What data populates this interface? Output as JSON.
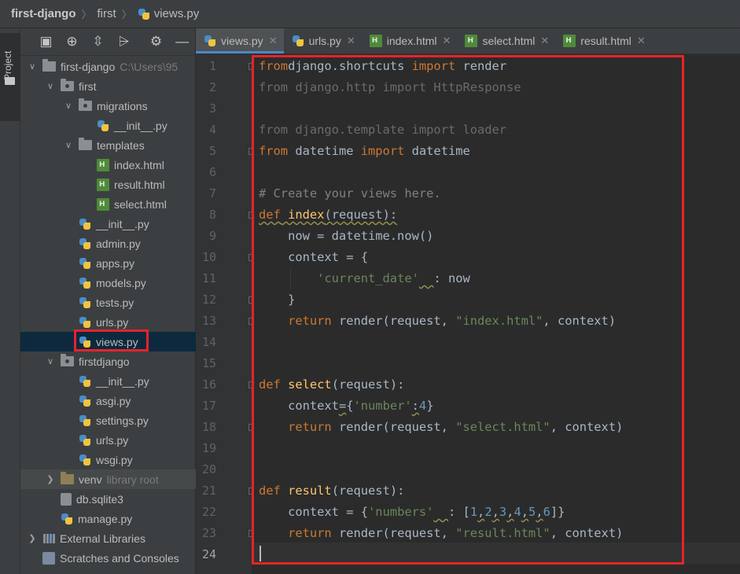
{
  "breadcrumb": [
    "first-django",
    "first",
    "views.py"
  ],
  "sidebar_tab": "Project",
  "panel_toolbar": [
    "project-view-icon",
    "locate-icon",
    "expand-all-icon",
    "collapse-all-icon",
    "gear-icon",
    "minimize-icon"
  ],
  "tree": [
    {
      "label": "first-django",
      "hint": "C:\\Users\\95",
      "kind": "folder",
      "depth": 0,
      "expanded": true
    },
    {
      "label": "first",
      "kind": "pkg",
      "depth": 1,
      "expanded": true
    },
    {
      "label": "migrations",
      "kind": "pkg",
      "depth": 2,
      "expanded": true
    },
    {
      "label": "__init__.py",
      "kind": "py",
      "depth": 3
    },
    {
      "label": "templates",
      "kind": "folder",
      "depth": 2,
      "expanded": true
    },
    {
      "label": "index.html",
      "kind": "html",
      "depth": 3
    },
    {
      "label": "result.html",
      "kind": "html",
      "depth": 3
    },
    {
      "label": "select.html",
      "kind": "html",
      "depth": 3
    },
    {
      "label": "__init__.py",
      "kind": "py",
      "depth": 2
    },
    {
      "label": "admin.py",
      "kind": "py",
      "depth": 2
    },
    {
      "label": "apps.py",
      "kind": "py",
      "depth": 2
    },
    {
      "label": "models.py",
      "kind": "py",
      "depth": 2
    },
    {
      "label": "tests.py",
      "kind": "py",
      "depth": 2
    },
    {
      "label": "urls.py",
      "kind": "py",
      "depth": 2
    },
    {
      "label": "views.py",
      "kind": "py",
      "depth": 2,
      "selected": true
    },
    {
      "label": "firstdjango",
      "kind": "pkg",
      "depth": 1,
      "expanded": true
    },
    {
      "label": "__init__.py",
      "kind": "py",
      "depth": 2
    },
    {
      "label": "asgi.py",
      "kind": "py",
      "depth": 2
    },
    {
      "label": "settings.py",
      "kind": "py",
      "depth": 2
    },
    {
      "label": "urls.py",
      "kind": "py",
      "depth": 2
    },
    {
      "label": "wsgi.py",
      "kind": "py",
      "depth": 2
    },
    {
      "label": "venv",
      "hint": "library root",
      "kind": "venv",
      "depth": 1,
      "expanded": false
    },
    {
      "label": "db.sqlite3",
      "kind": "db",
      "depth": 1
    },
    {
      "label": "manage.py",
      "kind": "py",
      "depth": 1
    },
    {
      "label": "External Libraries",
      "kind": "lib",
      "depth": 0,
      "expanded": false
    },
    {
      "label": "Scratches and Consoles",
      "kind": "scratch",
      "depth": 0
    }
  ],
  "tabs": [
    {
      "label": "views.py",
      "kind": "py",
      "active": true
    },
    {
      "label": "urls.py",
      "kind": "py"
    },
    {
      "label": "index.html",
      "kind": "html"
    },
    {
      "label": "select.html",
      "kind": "html"
    },
    {
      "label": "result.html",
      "kind": "html"
    }
  ],
  "code": [
    [
      [
        "kw",
        "from"
      ],
      [
        "",
        "django.shortcuts "
      ],
      [
        "kw",
        "import"
      ],
      [
        "",
        " render"
      ]
    ],
    [
      [
        "unused",
        "from django.http import HttpResponse"
      ]
    ],
    [],
    [
      [
        "unused",
        "from django.template import loader"
      ]
    ],
    [
      [
        "kw",
        "from"
      ],
      [
        "",
        " datetime "
      ],
      [
        "kw",
        "import"
      ],
      [
        "",
        " datetime"
      ]
    ],
    [],
    [
      [
        "cm",
        "# Create your views here."
      ]
    ],
    [
      [
        "kw squig",
        "def"
      ],
      [
        "squig",
        " "
      ],
      [
        "fn squig",
        "index"
      ],
      [
        "squig",
        "(request):"
      ]
    ],
    [
      [
        "",
        "    now = datetime.now()"
      ]
    ],
    [
      [
        "",
        "    context = {"
      ]
    ],
    [
      [
        "",
        "        "
      ],
      [
        "str",
        "'current_date'"
      ],
      [
        "squig",
        "  "
      ],
      [
        "",
        ": now"
      ]
    ],
    [
      [
        "",
        "    }"
      ]
    ],
    [
      [
        "",
        "    "
      ],
      [
        "kw",
        "return"
      ],
      [
        "",
        " render(request, "
      ],
      [
        "str",
        "\"index.html\""
      ],
      [
        "",
        ", context)"
      ]
    ],
    [],
    [],
    [
      [
        "kw",
        "def"
      ],
      [
        "",
        " "
      ],
      [
        "fn",
        "select"
      ],
      [
        "",
        "(request):"
      ]
    ],
    [
      [
        "",
        "    context"
      ],
      [
        "squig",
        "="
      ],
      [
        "",
        "{"
      ],
      [
        "str",
        "'number'"
      ],
      [
        "squig",
        ":"
      ],
      [
        "num",
        "4"
      ],
      [
        "",
        "}"
      ]
    ],
    [
      [
        "",
        "    "
      ],
      [
        "kw",
        "return"
      ],
      [
        "",
        " render(request, "
      ],
      [
        "str",
        "\"select.html\""
      ],
      [
        "",
        ", context)"
      ]
    ],
    [],
    [],
    [
      [
        "kw",
        "def"
      ],
      [
        "",
        " "
      ],
      [
        "fn",
        "result"
      ],
      [
        "",
        "(request):"
      ]
    ],
    [
      [
        "",
        "    context = {"
      ],
      [
        "str",
        "'numbers'"
      ],
      [
        "squig",
        "  "
      ],
      [
        "",
        ": ["
      ],
      [
        "num",
        "1"
      ],
      [
        "squig",
        ","
      ],
      [
        "num",
        "2"
      ],
      [
        "squig",
        ","
      ],
      [
        "num",
        "3"
      ],
      [
        "squig",
        ","
      ],
      [
        "num",
        "4"
      ],
      [
        "squig",
        ","
      ],
      [
        "num",
        "5"
      ],
      [
        "squig",
        ","
      ],
      [
        "num",
        "6"
      ],
      [
        "",
        "]}"
      ]
    ],
    [
      [
        "",
        "    "
      ],
      [
        "kw",
        "return"
      ],
      [
        "",
        " render(request, "
      ],
      [
        "str",
        "\"result.html\""
      ],
      [
        "",
        ", context)"
      ]
    ],
    []
  ],
  "current_line": 24,
  "colors": {
    "keyword": "#cc7832",
    "function": "#ffc66d",
    "string": "#6a8759",
    "number": "#6897bb",
    "comment": "#808080",
    "highlight": "#e5232a"
  }
}
